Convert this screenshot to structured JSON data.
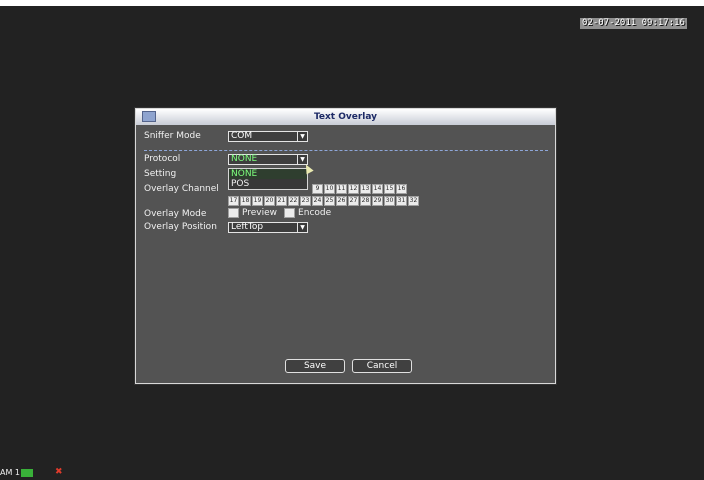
{
  "clock": "02-07-2011 09:17:16",
  "dialog": {
    "title": "Text Overlay",
    "sniffer_mode": {
      "label": "Sniffer Mode",
      "value": "COM"
    },
    "protocol": {
      "label": "Protocol",
      "value": "NONE",
      "options": [
        "NONE",
        "POS"
      ]
    },
    "setting": {
      "label": "Setting"
    },
    "overlay_channel": {
      "label": "Overlay Channel",
      "row1": [
        "9",
        "10",
        "11",
        "12",
        "13",
        "14",
        "15",
        "16"
      ],
      "row2": [
        "17",
        "18",
        "19",
        "20",
        "21",
        "22",
        "23",
        "24",
        "25",
        "26",
        "27",
        "28",
        "29",
        "30",
        "31",
        "32"
      ]
    },
    "overlay_mode": {
      "label": "Overlay Mode",
      "preview": "Preview",
      "encode": "Encode"
    },
    "overlay_position": {
      "label": "Overlay Position",
      "value": "LeftTop"
    },
    "save_label": "Save",
    "cancel_label": "Cancel"
  },
  "status": {
    "label": "AM 1",
    "rec_icon": "record-indicator",
    "alarm_icon": "alarm-icon"
  },
  "colors": {
    "selected_text": "#7dff7d",
    "alarm": "#e03b2b",
    "rec": "#39b039"
  }
}
